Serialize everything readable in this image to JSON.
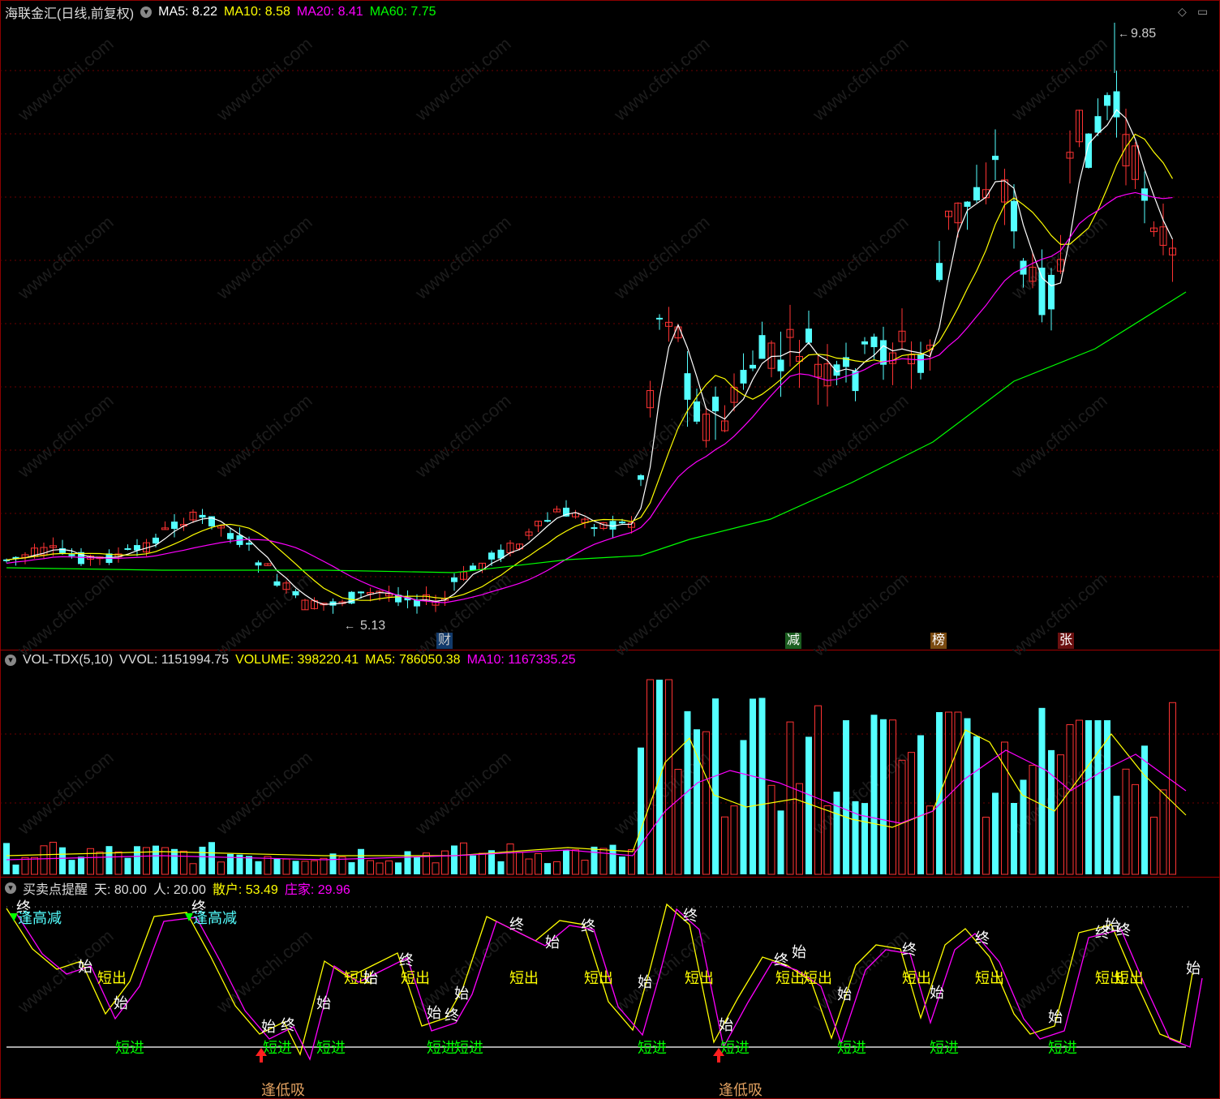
{
  "main": {
    "title": "海联金汇(日线,前复权)",
    "ma5": "MA5: 8.22",
    "ma10": "MA10: 8.58",
    "ma20": "MA20: 8.41",
    "ma60": "MA60: 7.75",
    "high_label": "9.85",
    "low_label": "5.13",
    "tags": [
      "财",
      "减",
      "榜",
      "张"
    ],
    "colors": {
      "ma5": "#ffffff",
      "ma10": "#ffff00",
      "ma20": "#ff00ff",
      "ma60": "#00ff00",
      "up": "#ff3333",
      "down": "#54ffff"
    }
  },
  "volume": {
    "name": "VOL-TDX(5,10)",
    "vvol": "VVOL: 1151994.75",
    "volume": "VOLUME: 398220.41",
    "ma5": "MA5: 786050.38",
    "ma10": "MA10: 1167335.25"
  },
  "signal": {
    "name": "买卖点提醒",
    "tian": "天: 80.00",
    "ren": "人: 20.00",
    "sanhu": "散户: 53.49",
    "zhuangjia": "庄家: 29.96",
    "labels": {
      "zhong": "终",
      "shi": "始",
      "duanchu": "短出",
      "duanjin": "短进",
      "fenggaojian": "逢高减",
      "fengdixi": "逢低吸"
    }
  },
  "watermark": "www.cfchi.com"
}
